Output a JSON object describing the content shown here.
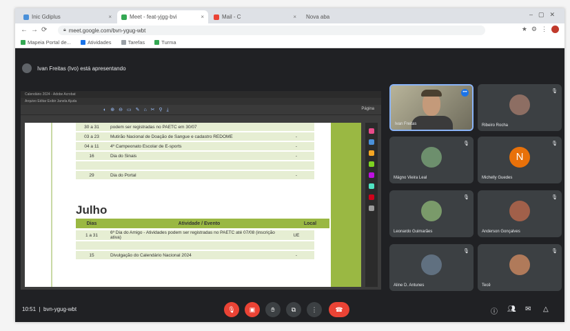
{
  "browser": {
    "tabs": [
      {
        "label": "Inic Gdiplus"
      },
      {
        "label": "Meet - feat-yjgg-bvi"
      },
      {
        "label": "Mail - C"
      },
      {
        "label": "Nova aba"
      }
    ],
    "url": "meet.google.com/bvn-ygug-wbt",
    "bookmarks": [
      {
        "label": "Mapeia Portal de...",
        "color": "#34a853"
      },
      {
        "label": "Atividades",
        "color": "#1a73e8"
      },
      {
        "label": "Tarefas",
        "color": "#9aa0a6"
      },
      {
        "label": "Turma",
        "color": "#34a853"
      }
    ]
  },
  "meet": {
    "presenter_banner": "Ivan Freitas (Ivo) está apresentando",
    "shared_window": {
      "title": "Calendário 2024 - Adobe Acrobat",
      "menu": "Arquivo Editar Exibir Janela Ajuda",
      "page_info": "Página"
    },
    "doc_rows_top": [
      {
        "dia": "30 a 31",
        "atividade": "podem ser registradas no PAETC em 30/07",
        "local": ""
      },
      {
        "dia": "03 a 23",
        "atividade": "Mutirão Nacional de Doação de Sangue e cadastro REDOME",
        "local": "-"
      },
      {
        "dia": "04 a 11",
        "atividade": "4º Campeonato Escolar de E-sports",
        "local": "-"
      },
      {
        "dia": "16",
        "atividade": "Dia do Sinais",
        "local": "-"
      },
      {
        "dia": "",
        "atividade": "",
        "local": ""
      },
      {
        "dia": "29",
        "atividade": "Dia do Portal",
        "local": "-"
      }
    ],
    "section_title": "Julho",
    "table_headers": [
      "Dias",
      "Atividade / Evento",
      "Local"
    ],
    "doc_rows_julho": [
      {
        "dia": "1 a 31",
        "atividade": "6º Dia do Amigo - Atividades podem ser registradas no PAETC até 07/08 (inscrição ativa)",
        "local": "UE"
      },
      {
        "dia": "",
        "atividade": "",
        "local": ""
      },
      {
        "dia": "15",
        "atividade": "Divulgação do Calendário Nacional 2024",
        "local": "-"
      }
    ],
    "participants": [
      {
        "name": "Ivan Freitas",
        "type": "video"
      },
      {
        "name": "Ribeiro Rocha",
        "type": "avatar",
        "color": "#8d6e63"
      },
      {
        "name": "Mágno Vieira Leal",
        "type": "avatar",
        "color": "#6d8f6d"
      },
      {
        "name": "Michelly Guedes",
        "type": "letter",
        "letter": "N",
        "color": "#e8710a"
      },
      {
        "name": "Leonardo Guimarães",
        "type": "avatar",
        "color": "#7a9a6a"
      },
      {
        "name": "Anderson Gonçalves",
        "type": "avatar",
        "color": "#a1604a"
      },
      {
        "name": "Aline D. Antunes",
        "type": "avatar",
        "color": "#607080"
      },
      {
        "name": "Tecê",
        "type": "avatar",
        "color": "#b07a5a"
      }
    ],
    "clock": "10:51",
    "meeting_code": "bvn-ygug-wbt",
    "controls": [
      "mic-off",
      "camera-off",
      "raise-hand",
      "present",
      "more",
      "leave-call"
    ],
    "colors": {
      "accent": "#9ab843",
      "danger": "#ea4335",
      "bg": "#202124"
    }
  }
}
